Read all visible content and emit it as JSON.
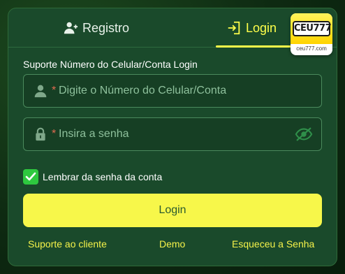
{
  "tabs": {
    "register_label": "Registro",
    "login_label": "Login",
    "active": "Login"
  },
  "brand": {
    "logo_text": "CEU777",
    "url_text": "ceu777.com"
  },
  "form": {
    "field_label": "Suporte Número do Celular/Conta Login",
    "phone": {
      "required_marker": "*",
      "placeholder": "Digite o Número do Celular/Conta",
      "value": ""
    },
    "password": {
      "required_marker": "*",
      "placeholder": "Insira a senha",
      "value": ""
    },
    "remember": {
      "label": "Lembrar da senha da conta",
      "checked": true
    },
    "login_button_label": "Login"
  },
  "footer_links": {
    "support": "Suporte ao cliente",
    "demo": "Demo",
    "forgot": "Esqueceu a Senha"
  },
  "icons": {
    "register_tab": "add-user-icon",
    "login_tab": "login-door-icon",
    "phone_field": "user-icon",
    "password_field": "lock-icon",
    "password_toggle": "eye-off-icon",
    "remember": "checkmark-icon"
  },
  "colors": {
    "accent_yellow": "#ffff4a",
    "button_yellow": "#f7f74a",
    "panel_green": "#1a4a2b",
    "check_green": "#2ec93f",
    "required_red": "#e06a50"
  }
}
